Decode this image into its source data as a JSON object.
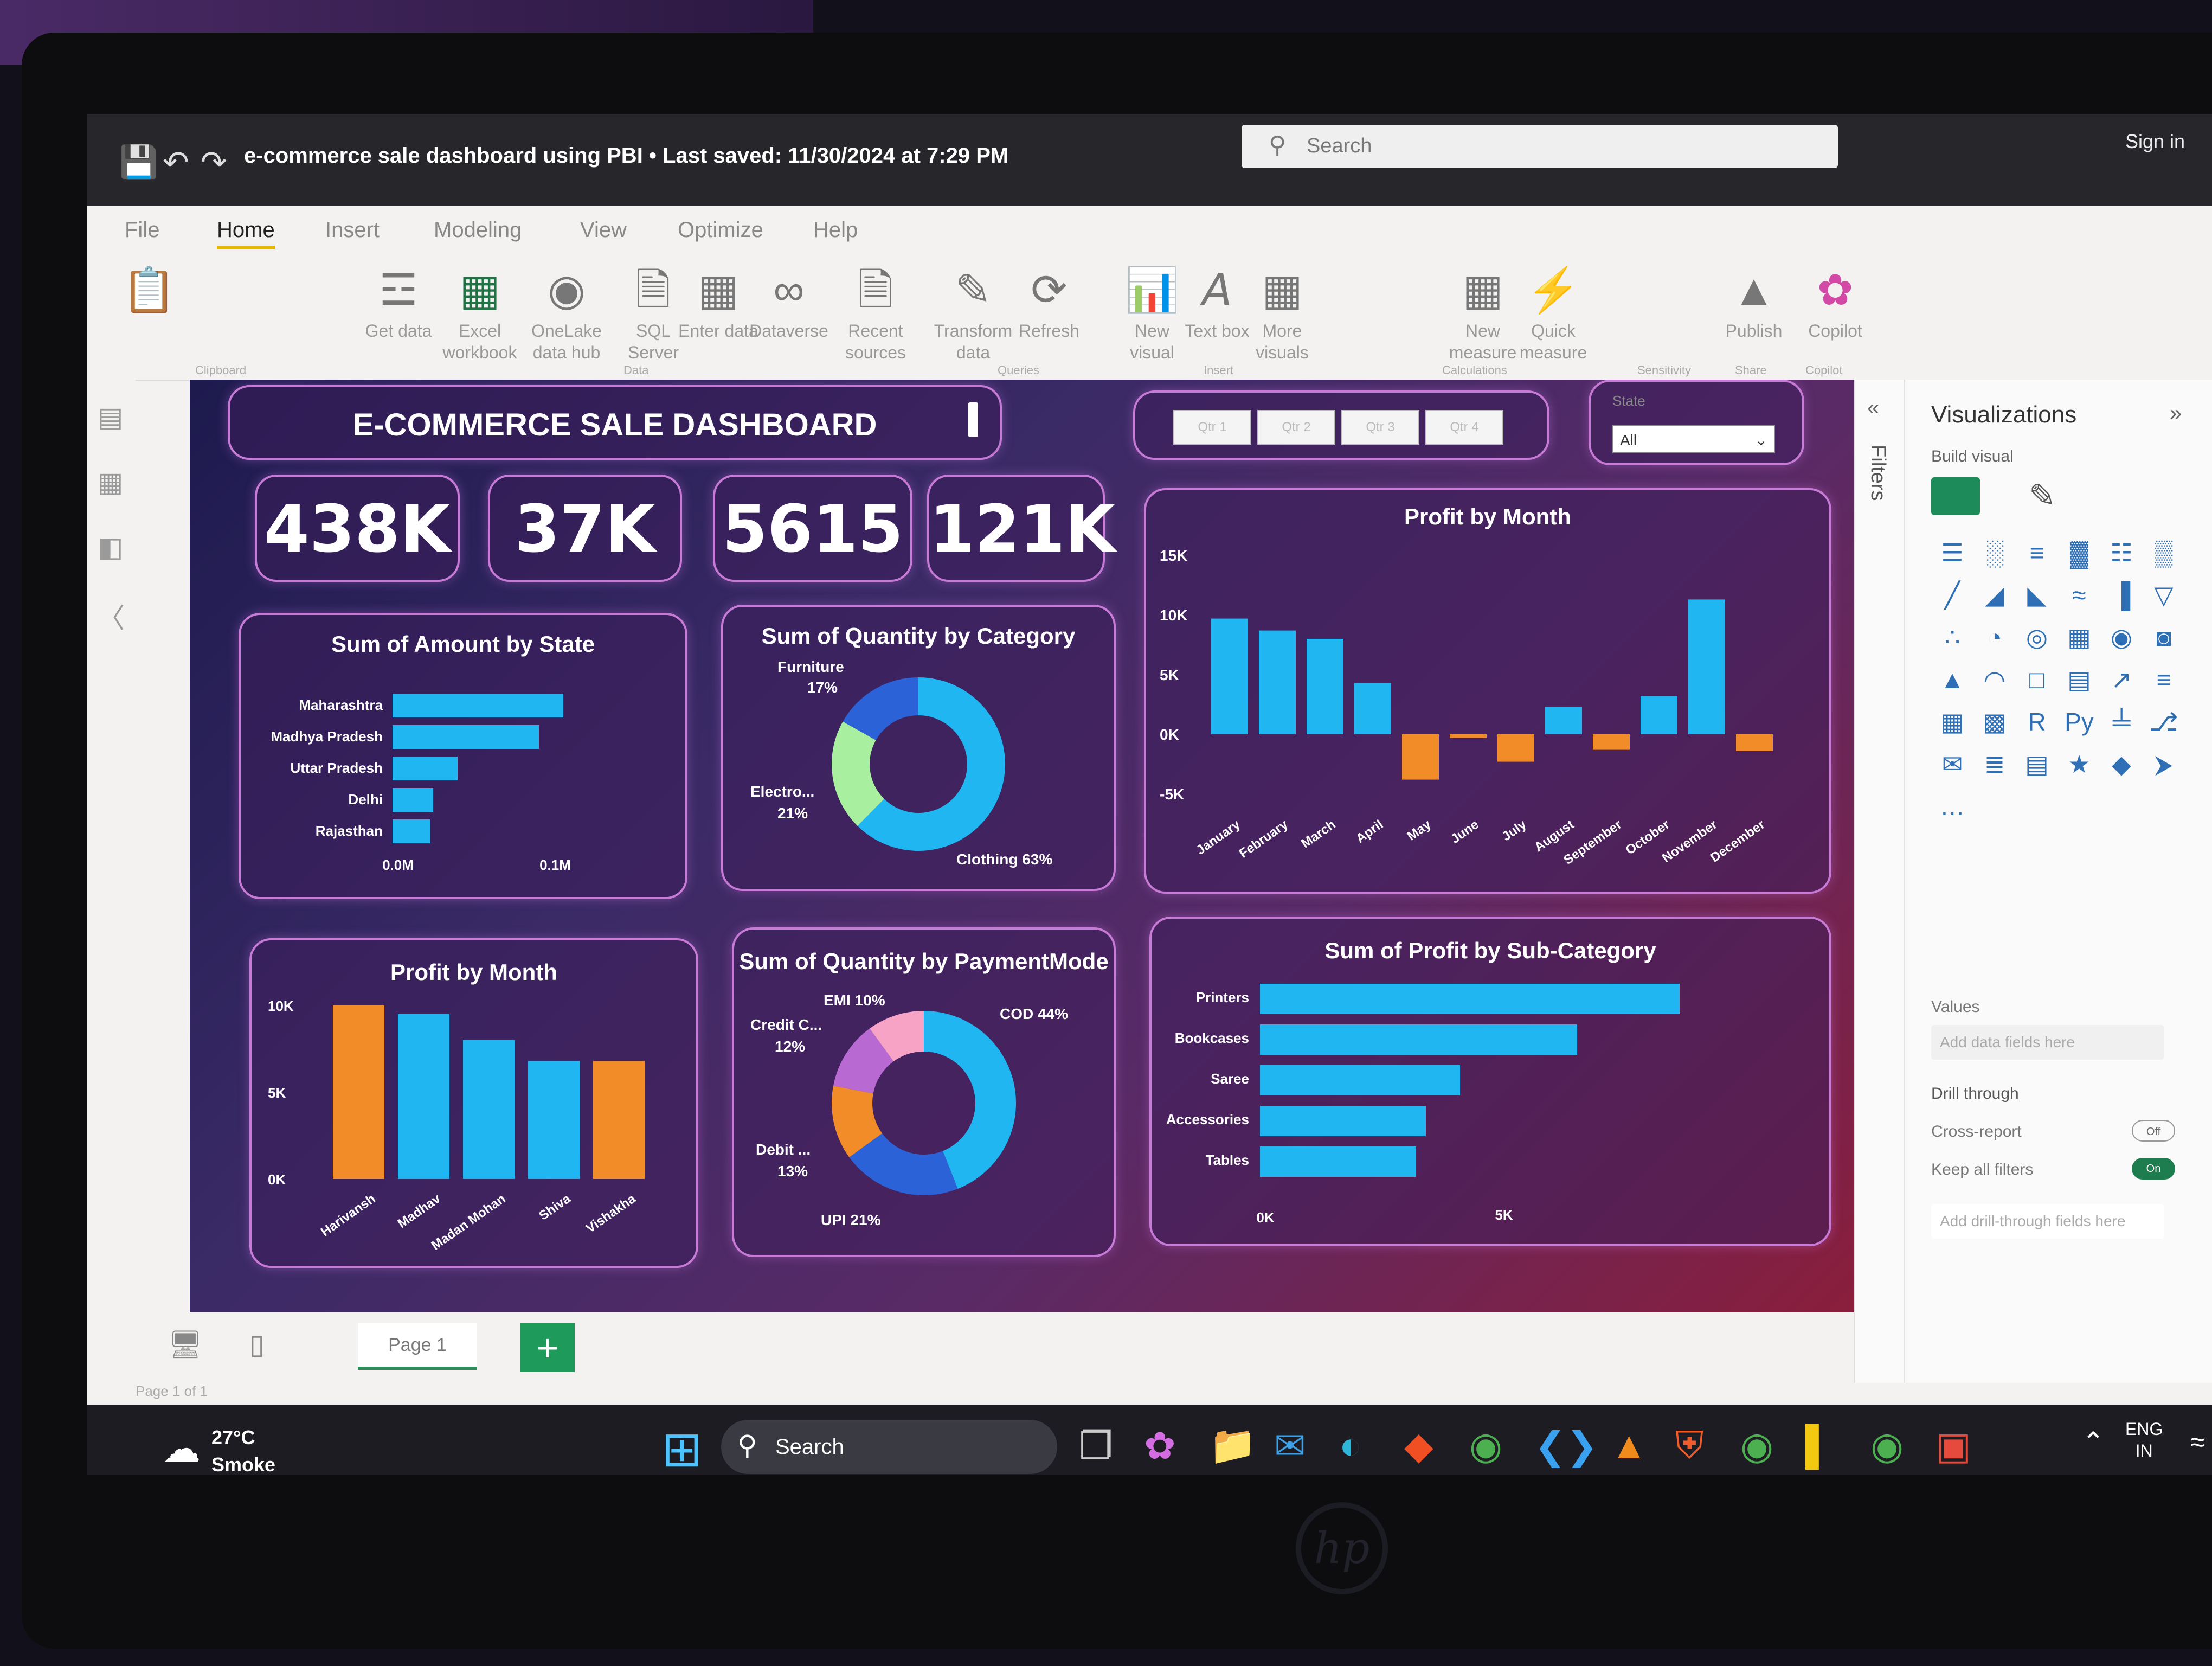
{
  "titlebar": {
    "doc_title": "e-commerce sale dashboard using PBI • Last saved: 11/30/2024 at 7:29 PM",
    "search_placeholder": "Search",
    "sign_in": "Sign in"
  },
  "menu": [
    "File",
    "Home",
    "Insert",
    "Modeling",
    "View",
    "Optimize",
    "Help"
  ],
  "menu_active": "Home",
  "ribbon": {
    "get_data": "Get data",
    "excel": "Excel workbook",
    "onelake": "OneLake data hub",
    "sql": "SQL Server",
    "enter_data": "Enter data",
    "dataverse": "Dataverse",
    "recent": "Recent sources",
    "transform": "Transform data",
    "refresh": "Refresh",
    "new_visual": "New visual",
    "text_box": "Text box",
    "more_visuals": "More visuals",
    "new_measure": "New measure",
    "quick_measure": "Quick measure",
    "publish": "Publish",
    "copilot": "Copilot",
    "groups": {
      "clipboard": "Clipboard",
      "data": "Data",
      "queries": "Queries",
      "insert": "Insert",
      "calculations": "Calculations",
      "sensitivity": "Sensitivity",
      "share": "Share",
      "copilot": "Copilot"
    }
  },
  "dashboard": {
    "title": "E-COMMERCE SALE DASHBOARD",
    "kpis": [
      "438K",
      "37K",
      "5615",
      "121K"
    ],
    "quarters": [
      "Qtr 1",
      "Qtr 2",
      "Qtr 3",
      "Qtr 4"
    ],
    "state_slicer": {
      "label": "State",
      "value": "All"
    }
  },
  "charts": {
    "amount_by_state": {
      "title": "Sum of Amount by State",
      "type": "bar",
      "categories": [
        "Maharashtra",
        "Madhya Pradesh",
        "Uttar Pradesh",
        "Delhi",
        "Rajasthan"
      ],
      "values": [
        0.105,
        0.09,
        0.04,
        0.025,
        0.023
      ],
      "x_ticks": [
        "0.0M",
        "0.1M"
      ],
      "xlim": [
        0,
        0.1
      ]
    },
    "qty_by_category": {
      "title": "Sum of Quantity by Category",
      "type": "pie",
      "labels": [
        "Clothing",
        "Electronics",
        "Furniture"
      ],
      "label_text": [
        "Clothing 63%",
        "Electro...",
        "21%",
        "Furniture",
        "17%"
      ],
      "values": [
        63,
        21,
        17
      ],
      "colors": [
        "#1fb6f2",
        "#a8f0a0",
        "#2b62d8"
      ]
    },
    "profit_by_month_top": {
      "title": "Profit by Month",
      "type": "bar",
      "categories": [
        "January",
        "February",
        "March",
        "April",
        "May",
        "June",
        "July",
        "August",
        "September",
        "October",
        "November",
        "December"
      ],
      "values": [
        9700,
        8700,
        8000,
        4300,
        -3800,
        -300,
        -2300,
        2300,
        -1300,
        3200,
        11300,
        -1400
      ],
      "y_ticks": [
        "15K",
        "10K",
        "5K",
        "0K",
        "-5K"
      ],
      "ylim": [
        -5000,
        15000
      ],
      "positive_color": "#1fb6f2",
      "negative_color": "#f28c28"
    },
    "profit_by_person": {
      "title": "Profit by Month",
      "type": "bar",
      "categories": [
        "Harivansh",
        "Madhav",
        "Madan Mohan",
        "Shiva",
        "Vishakha"
      ],
      "values": [
        10000,
        9500,
        8000,
        6800,
        6800
      ],
      "colors": [
        "#f28c28",
        "#1fb6f2",
        "#1fb6f2",
        "#1fb6f2",
        "#f28c28"
      ],
      "y_ticks": [
        "10K",
        "5K",
        "0K"
      ],
      "ylim": [
        0,
        10000
      ]
    },
    "qty_by_payment": {
      "title": "Sum of Quantity by PaymentMode",
      "type": "pie",
      "labels": [
        "COD",
        "UPI",
        "Debit Card",
        "Credit Card",
        "EMI"
      ],
      "label_text": [
        "COD 44%",
        "UPI 21%",
        "Debit ...",
        "13%",
        "Credit C...",
        "12%",
        "EMI 10%"
      ],
      "values": [
        44,
        21,
        13,
        12,
        10
      ],
      "colors": [
        "#1fb6f2",
        "#2b62d8",
        "#f28c28",
        "#b86ad2",
        "#f6a3c6"
      ]
    },
    "profit_by_subcat": {
      "title": "Sum of Profit by Sub-Category",
      "type": "bar",
      "categories": [
        "Printers",
        "Bookcases",
        "Saree",
        "Accessories",
        "Tables"
      ],
      "values": [
        8600,
        6500,
        4100,
        3400,
        3200
      ],
      "x_ticks": [
        "0K",
        "5K"
      ],
      "xlim": [
        0,
        10000
      ]
    }
  },
  "chart_data": [
    {
      "type": "bar",
      "title": "Sum of Amount by State",
      "categories": [
        "Maharashtra",
        "Madhya Pradesh",
        "Uttar Pradesh",
        "Delhi",
        "Rajasthan"
      ],
      "values": [
        0.105,
        0.09,
        0.04,
        0.025,
        0.023
      ],
      "xlim": [
        0,
        0.1
      ]
    },
    {
      "type": "pie",
      "title": "Sum of Quantity by Category",
      "labels": [
        "Clothing",
        "Electronics",
        "Furniture"
      ],
      "values": [
        63,
        21,
        17
      ]
    },
    {
      "type": "bar",
      "title": "Profit by Month",
      "categories": [
        "January",
        "February",
        "March",
        "April",
        "May",
        "June",
        "July",
        "August",
        "September",
        "October",
        "November",
        "December"
      ],
      "values": [
        9700,
        8700,
        8000,
        4300,
        -3800,
        -300,
        -2300,
        2300,
        -1300,
        3200,
        11300,
        -1400
      ],
      "ylim": [
        -5000,
        15000
      ]
    },
    {
      "type": "bar",
      "title": "Profit by Month",
      "categories": [
        "Harivansh",
        "Madhav",
        "Madan Mohan",
        "Shiva",
        "Vishakha"
      ],
      "values": [
        10000,
        9500,
        8000,
        6800,
        6800
      ],
      "ylim": [
        0,
        10000
      ]
    },
    {
      "type": "pie",
      "title": "Sum of Quantity by PaymentMode",
      "labels": [
        "COD",
        "UPI",
        "Debit Card",
        "Credit Card",
        "EMI"
      ],
      "values": [
        44,
        21,
        13,
        12,
        10
      ]
    },
    {
      "type": "bar",
      "title": "Sum of Profit by Sub-Category",
      "categories": [
        "Printers",
        "Bookcases",
        "Saree",
        "Accessories",
        "Tables"
      ],
      "values": [
        8600,
        6500,
        4100,
        3400,
        3200
      ],
      "xlim": [
        0,
        10000
      ]
    }
  ],
  "viz_panel": {
    "title": "Visualizations",
    "build_visual": "Build visual",
    "filters": "Filters",
    "values_label": "Values",
    "values_placeholder": "Add data fields here",
    "drill_through": "Drill through",
    "cross_report": "Cross-report",
    "cross_report_state": "Off",
    "keep_filters": "Keep all filters",
    "keep_filters_state": "On",
    "drill_placeholder": "Add drill-through fields here",
    "icons": [
      "stacked-bar",
      "stacked-column",
      "clustered-bar",
      "clustered-column",
      "100-bar",
      "100-column",
      "line",
      "area",
      "stacked-area",
      "ribbon",
      "waterfall",
      "funnel",
      "scatter",
      "pie",
      "donut",
      "treemap",
      "map",
      "filled-map",
      "azure-map",
      "gauge",
      "card",
      "multi-card",
      "kpi",
      "slicer",
      "table",
      "matrix",
      "r-visual",
      "python-visual",
      "key-influencers",
      "decomposition",
      "qa",
      "narrative",
      "paginated",
      "trophy",
      "power-apps",
      "power-automate",
      "more"
    ]
  },
  "pages": {
    "tab": "Page 1",
    "status": "Page 1 of 1"
  },
  "taskbar": {
    "weather_temp": "27°C",
    "weather_desc": "Smoke",
    "search": "Search",
    "lang1": "ENG",
    "lang2": "IN"
  }
}
